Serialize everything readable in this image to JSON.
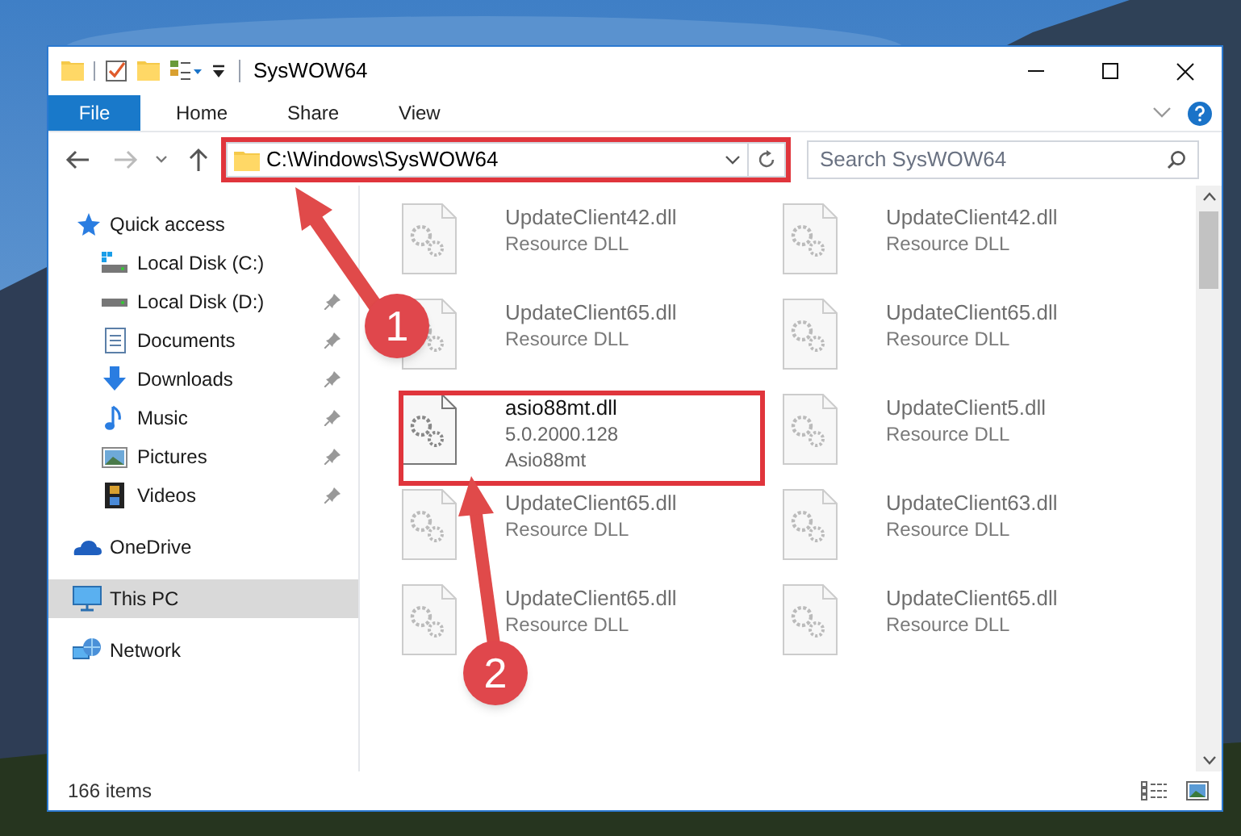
{
  "window": {
    "title": "SysWOW64"
  },
  "ribbon": {
    "tabs": [
      {
        "label": "File",
        "kind": "file"
      },
      {
        "label": "Home",
        "kind": "tab"
      },
      {
        "label": "Share",
        "kind": "tab"
      },
      {
        "label": "View",
        "kind": "tab"
      }
    ]
  },
  "address_bar": {
    "path": "C:\\Windows\\SysWOW64"
  },
  "search": {
    "placeholder": "Search SysWOW64"
  },
  "sidebar": {
    "items": [
      {
        "label": "Quick access",
        "selected": false,
        "children": [
          {
            "label": "Local Disk (C:)",
            "pinned": false,
            "selected": false
          },
          {
            "label": "Local Disk (D:)",
            "pinned": true,
            "selected": false
          },
          {
            "label": "Documents",
            "pinned": true,
            "selected": false
          },
          {
            "label": "Downloads",
            "pinned": true,
            "selected": false
          },
          {
            "label": "Music",
            "pinned": true,
            "selected": false
          },
          {
            "label": "Pictures",
            "pinned": true,
            "selected": false
          },
          {
            "label": "Videos",
            "pinned": true,
            "selected": false
          }
        ]
      },
      {
        "label": "OneDrive",
        "selected": false
      },
      {
        "label": "This PC",
        "selected": true
      },
      {
        "label": "Network",
        "selected": false
      }
    ]
  },
  "files": [
    {
      "name": "UpdateClient42.dll",
      "details": [
        "Resource DLL"
      ],
      "kind": "blurred"
    },
    {
      "name": "UpdateClient42.dll",
      "details": [
        "Resource DLL"
      ],
      "kind": "blurred"
    },
    {
      "name": "UpdateClient65.dll",
      "details": [
        "Resource DLL"
      ],
      "kind": "blurred"
    },
    {
      "name": "UpdateClient65.dll",
      "details": [
        "Resource DLL"
      ],
      "kind": "blurred"
    },
    {
      "name": "asio88mt.dll",
      "details": [
        "5.0.2000.128",
        "Asio88mt"
      ],
      "kind": "plain"
    },
    {
      "name": "UpdateClient5.dll",
      "details": [
        "Resource DLL"
      ],
      "kind": "blurred"
    },
    {
      "name": "UpdateClient65.dll",
      "details": [
        "Resource DLL"
      ],
      "kind": "blurred"
    },
    {
      "name": "UpdateClient63.dll",
      "details": [
        "Resource DLL"
      ],
      "kind": "blurred"
    },
    {
      "name": "UpdateClient65.dll",
      "details": [
        "Resource DLL"
      ],
      "kind": "blurred"
    },
    {
      "name": "UpdateClient65.dll",
      "details": [
        "Resource DLL"
      ],
      "kind": "blurred"
    }
  ],
  "status_bar": {
    "item_count": "166 items"
  },
  "annotations": [
    {
      "label": "1"
    },
    {
      "label": "2"
    }
  ]
}
